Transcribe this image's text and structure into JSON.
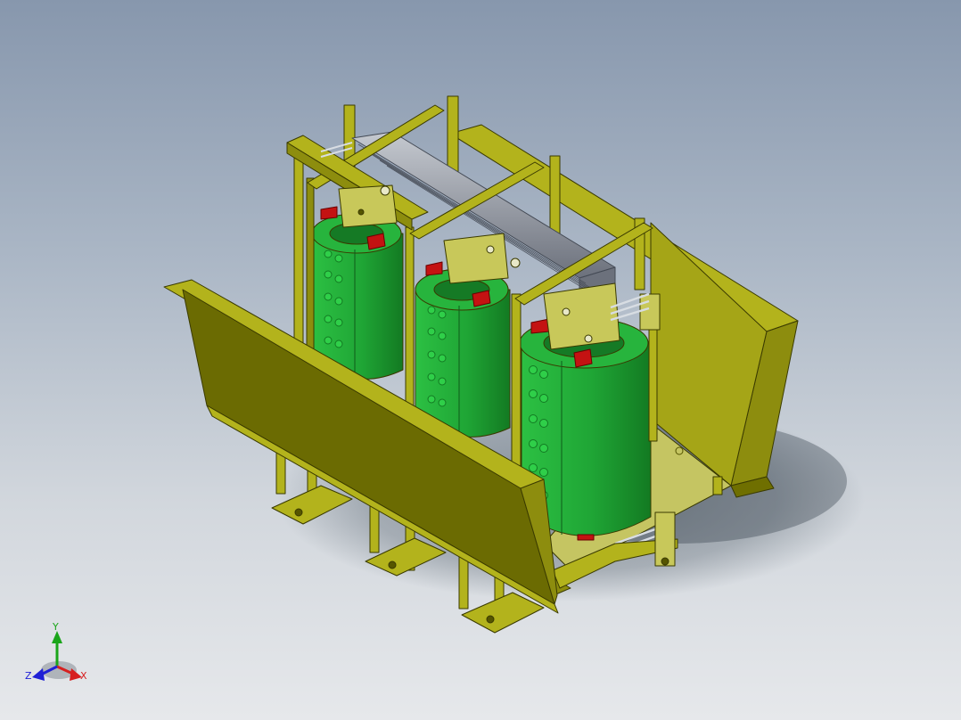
{
  "colors": {
    "frame": "#b3b31c",
    "frame_dark": "#5f5f00",
    "frame_edge": "#3a3a00",
    "coil": "#1fa535",
    "coil_dark": "#157a25",
    "core": "#7f8591",
    "accent_red": "#c41212",
    "axis_x": "#d62020",
    "axis_y": "#1aa51a",
    "axis_z": "#2020d6"
  },
  "triad": {
    "x_label": "X",
    "y_label": "Y",
    "z_label": "Z"
  }
}
